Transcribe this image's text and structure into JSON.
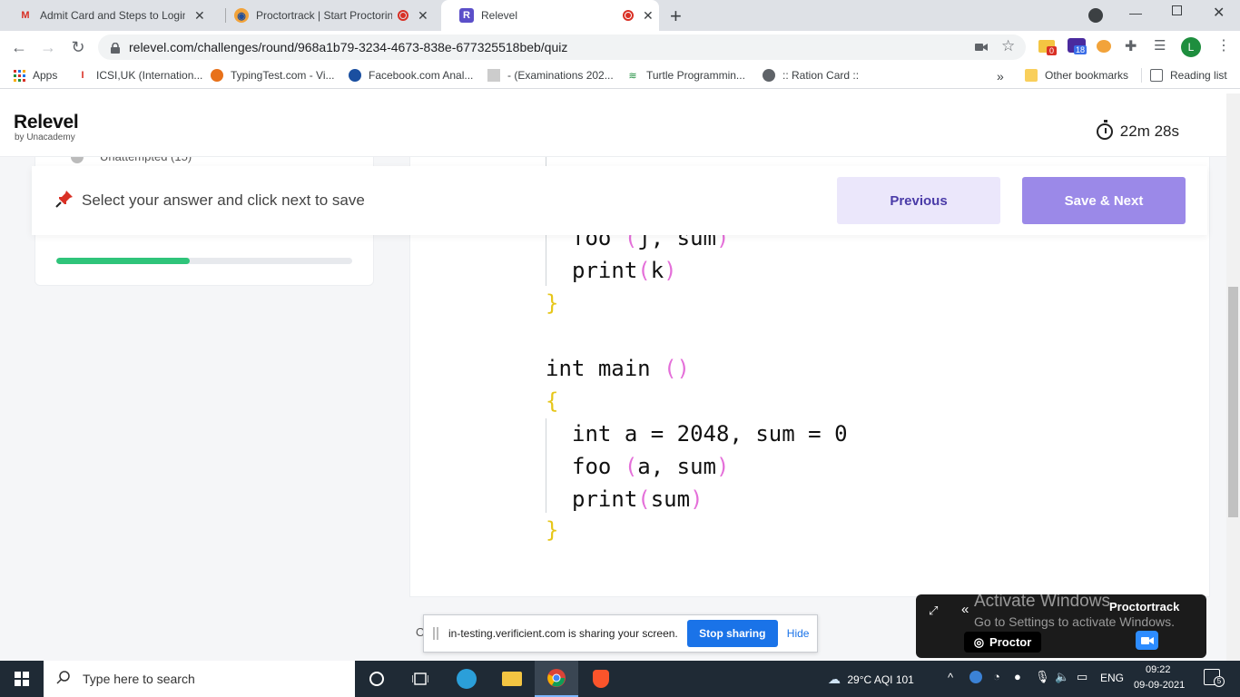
{
  "browser": {
    "tabs": [
      {
        "label": "Admit Card and Steps to Login fo",
        "favicon": "gmail-icon"
      },
      {
        "label": "Proctortrack | Start Proctorin",
        "favicon": "proctortrack-icon"
      },
      {
        "label": "Relevel",
        "favicon": "relevel-icon",
        "active": true
      }
    ],
    "url": "relevel.com/challenges/round/968a1b79-3234-4673-838e-677325518beb/quiz",
    "extensions": {
      "mail_badge": "0",
      "hat_badge": "18",
      "profile_initial": "L"
    },
    "bookmarks": [
      {
        "label": "Apps"
      },
      {
        "label": "ICSI,UK (Internation..."
      },
      {
        "label": "TypingTest.com - Vi..."
      },
      {
        "label": "Facebook.com Anal..."
      },
      {
        "label": "- (Examinations 202..."
      },
      {
        "label": "Turtle Programmin..."
      },
      {
        "label": ":: Ration Card ::"
      }
    ],
    "other_bookmarks": "Other bookmarks",
    "reading_list": "Reading list",
    "more": "»"
  },
  "app": {
    "logo": "Relevel",
    "logo_sub": "by Unacademy",
    "timer": "22m 28s",
    "unattempted": "Unattempted (15)",
    "progress": 0.45,
    "save_message": "Select your answer and click next to save",
    "previous_label": "Previous",
    "next_label": "Save & Next"
  },
  "code": {
    "line_call": "foo (j, sum)",
    "line_print_k": "print(k)",
    "main_sig": "int main ()",
    "decl": "int a = 2048, sum = 0",
    "call_a": "foo (a, sum)",
    "print_sum": "print(sum)"
  },
  "screen_share": {
    "message": "in-testing.verificient.com is sharing your screen.",
    "stop_label": "Stop sharing",
    "hide_label": "Hide",
    "behind_char": "O"
  },
  "proctor_widget": {
    "watermark_title": "Activate Windows",
    "watermark_sub": "Go to Settings to activate Windows.",
    "brand": "Proctortrack",
    "proctor_label": "Proctor"
  },
  "taskbar": {
    "search_placeholder": "Type here to search",
    "weather": "29°C  AQI 101",
    "language": "ENG",
    "time": "09:22",
    "date": "09-09-2021",
    "notifications": "5"
  },
  "colors": {
    "accent_purple": "#9b89e8",
    "progress_green": "#2fc47a",
    "paren_pink": "#e46fd9",
    "brace_yellow": "#e6c619"
  }
}
